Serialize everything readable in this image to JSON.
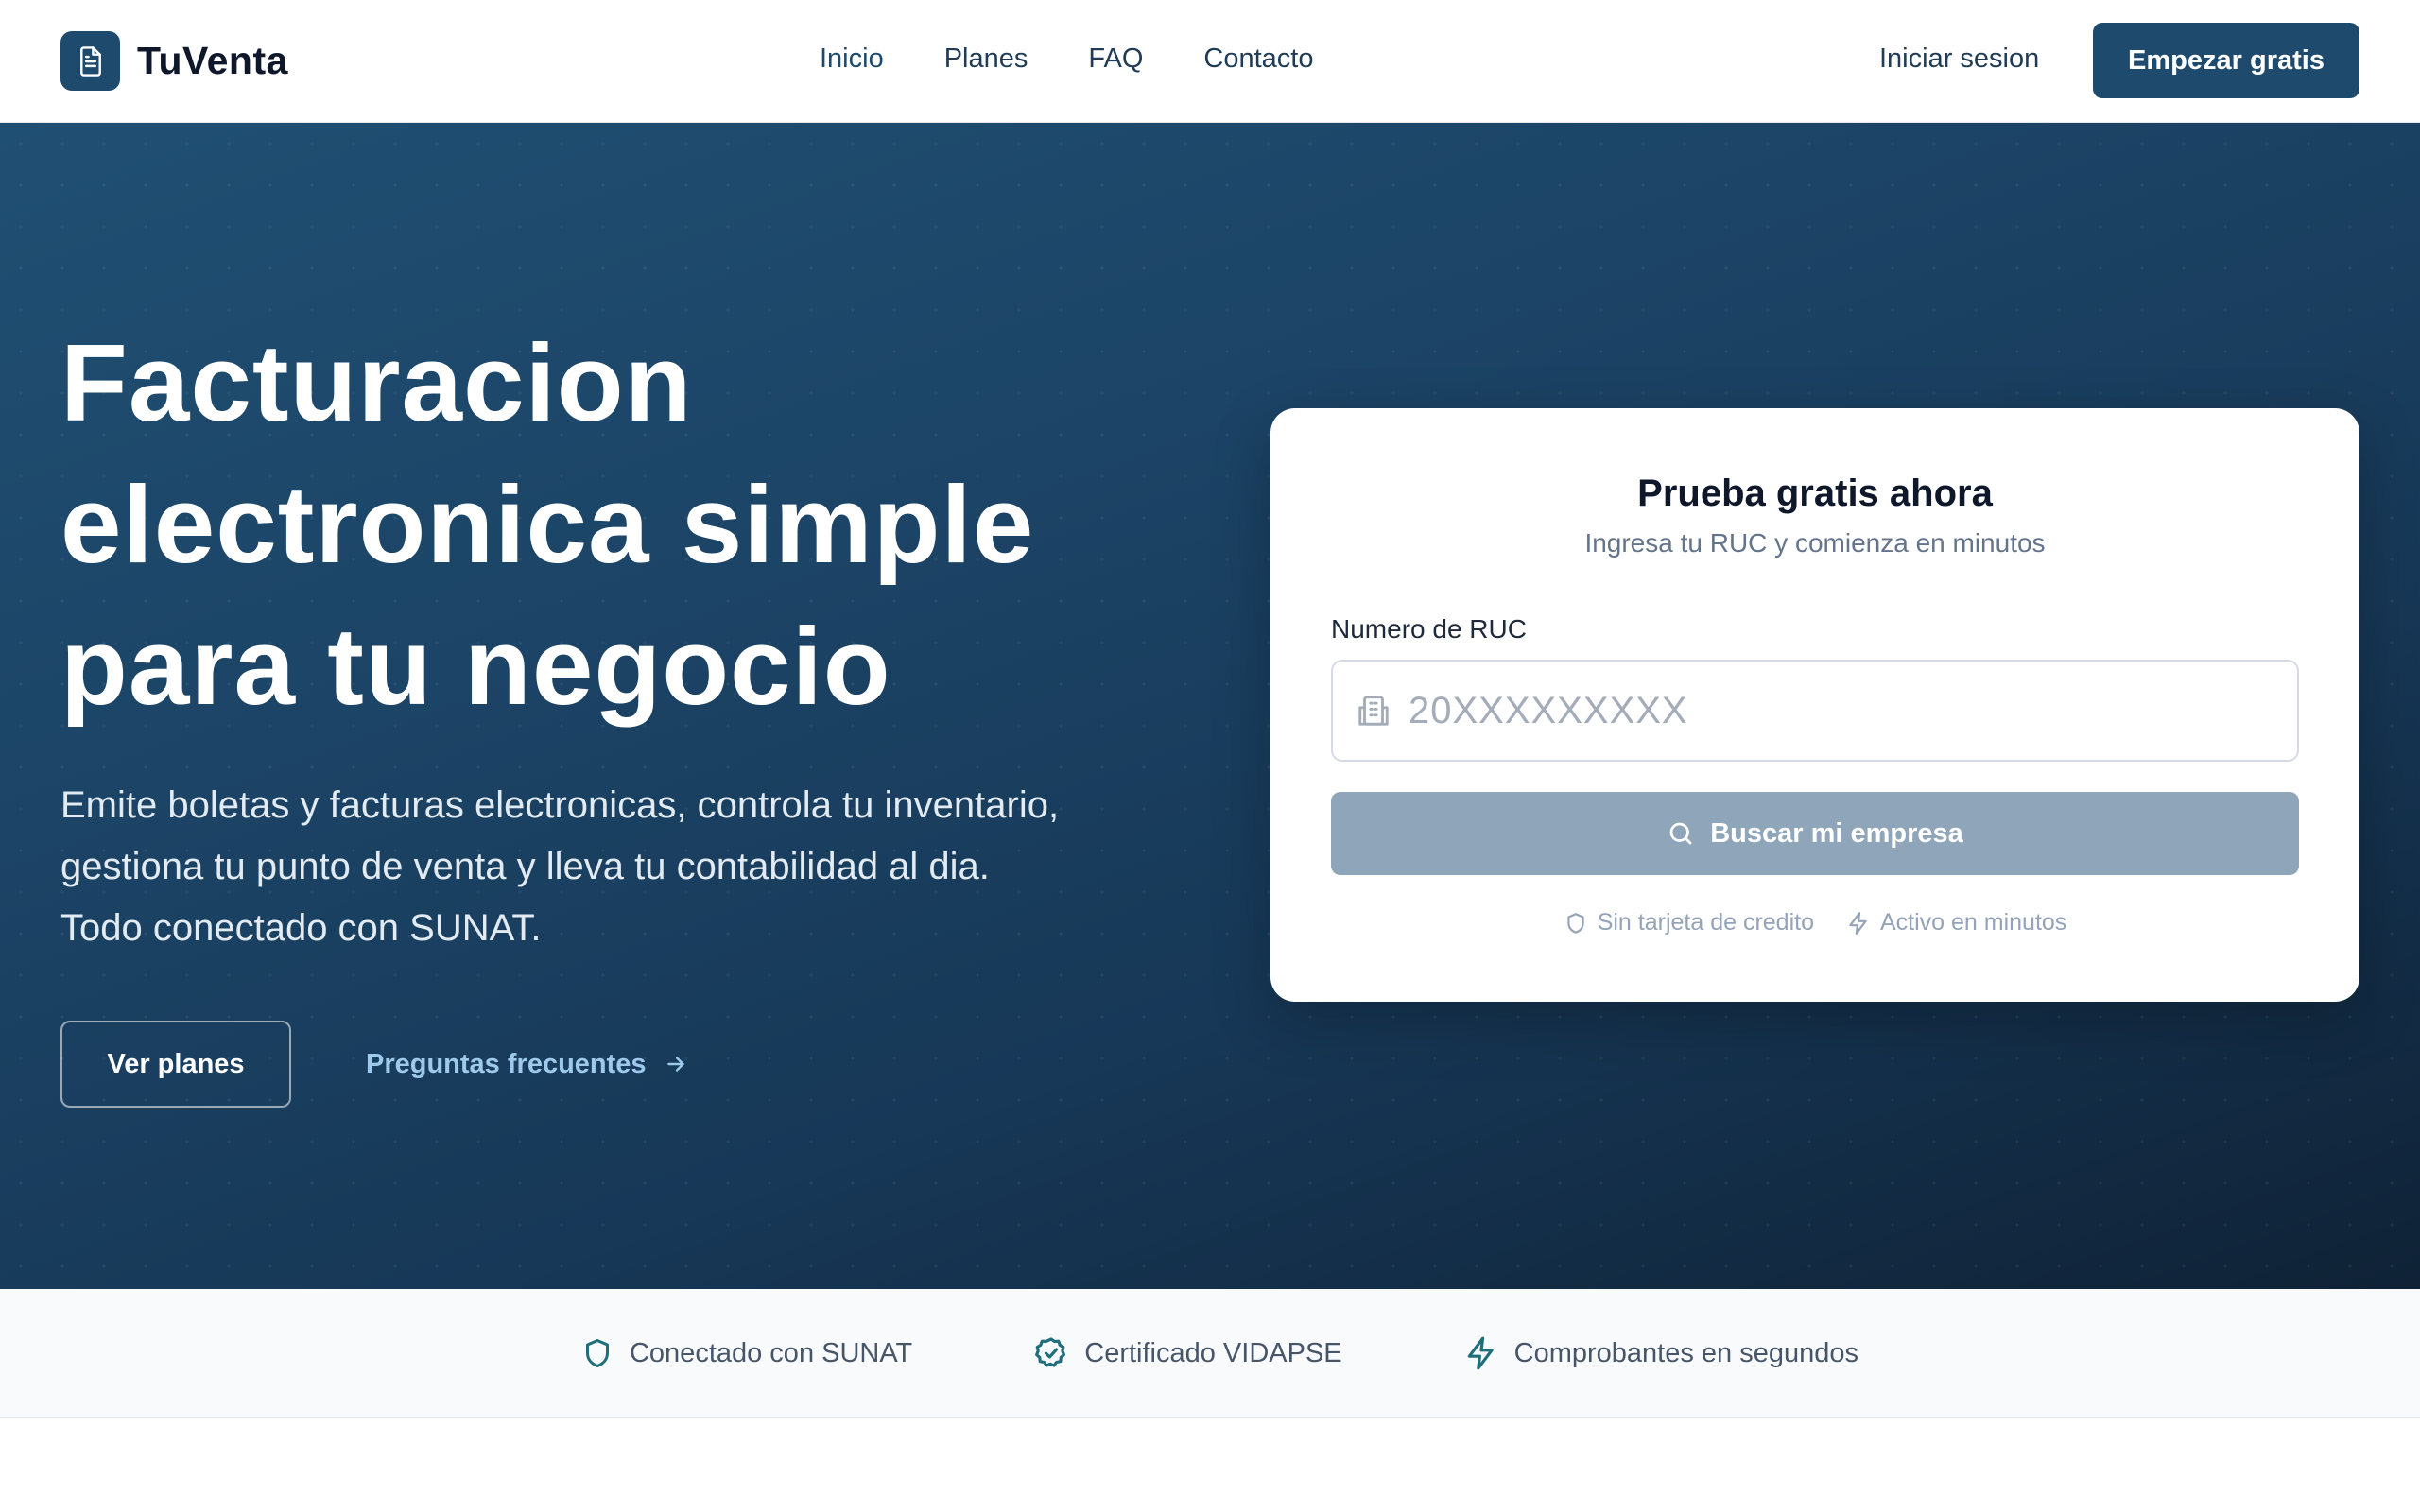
{
  "header": {
    "brand": "TuVenta",
    "nav": [
      "Inicio",
      "Planes",
      "FAQ",
      "Contacto"
    ],
    "login": "Iniciar sesion",
    "cta": "Empezar gratis"
  },
  "hero": {
    "title_lines": [
      "Facturacion",
      "electronica simple",
      "para tu negocio"
    ],
    "subtitle_lines": [
      "Emite boletas y facturas electronicas, controla tu inventario,",
      "gestiona tu punto de venta y lleva tu contabilidad al dia.",
      "Todo conectado con SUNAT."
    ],
    "btn_plans": "Ver planes",
    "link_faq": "Preguntas frecuentes"
  },
  "card": {
    "title": "Prueba gratis ahora",
    "subtitle": "Ingresa tu RUC y comienza en minutos",
    "field_label": "Numero de RUC",
    "input_placeholder": "20XXXXXXXXX",
    "search_button": "Buscar mi empresa",
    "perks": [
      "Sin tarjeta de credito",
      "Activo en minutos"
    ]
  },
  "trust": [
    "Conectado con SUNAT",
    "Certificado VIDAPSE",
    "Comprobantes en segundos"
  ],
  "colors": {
    "primary": "#1e4a6e",
    "hero_dark": "#0f2236",
    "accent_teal": "#1f6e7a",
    "link_light": "#9ec9ea",
    "disabled_button": "#8fa5b9"
  }
}
